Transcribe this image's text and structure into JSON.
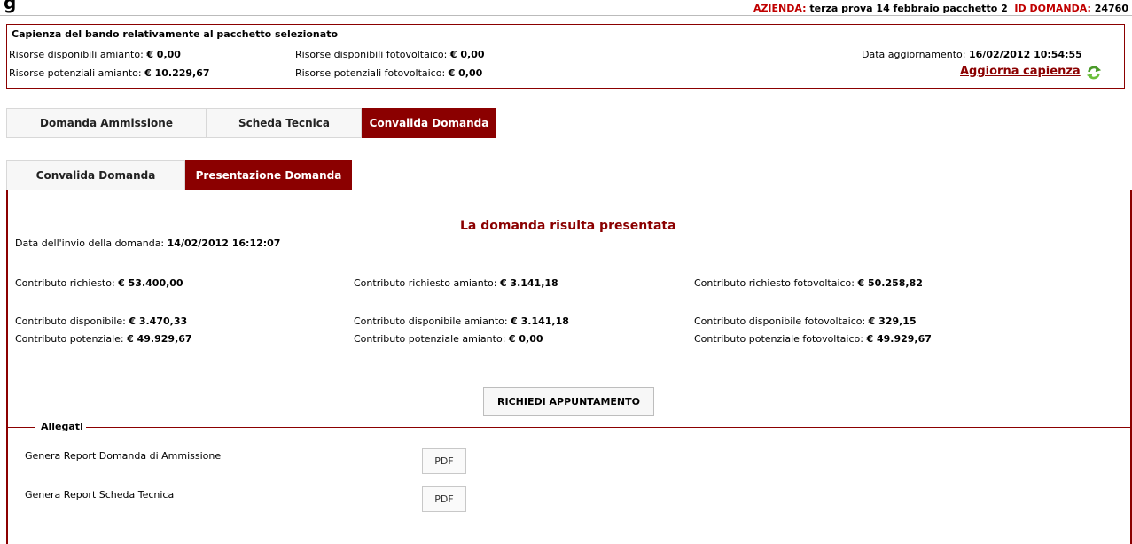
{
  "page_heading_glyph": "g",
  "header": {
    "azienda_label": "AZIENDA:",
    "azienda_value": "terza prova 14 febbraio pacchetto 2",
    "id_label": "ID DOMANDA:",
    "id_value": "24760"
  },
  "capienza": {
    "title": "Capienza del bando relativamente al pacchetto selezionato",
    "disp_amianto_label": "Risorse disponibili amianto:",
    "disp_amianto_value": "€ 0,00",
    "disp_foto_label": "Risorse disponibili fotovoltaico:",
    "disp_foto_value": "€ 0,00",
    "pot_amianto_label": "Risorse potenziali amianto:",
    "pot_amianto_value": "€ 10.229,67",
    "pot_foto_label": "Risorse potenziali fotovoltaico:",
    "pot_foto_value": "€ 0,00",
    "data_agg_label": "Data aggiornamento:",
    "data_agg_value": "16/02/2012 10:54:55",
    "aggiorna_link": "Aggiorna capienza"
  },
  "main_tabs": [
    {
      "label": "Domanda Ammissione",
      "active": false
    },
    {
      "label": "Scheda Tecnica",
      "active": false
    },
    {
      "label": "Convalida Domanda",
      "active": true
    }
  ],
  "sub_tabs": [
    {
      "label": "Convalida Domanda",
      "active": false
    },
    {
      "label": "Presentazione Domanda",
      "active": true
    }
  ],
  "panel": {
    "status_title": "La domanda risulta presentata",
    "invio_label": "Data dell'invio della domanda:",
    "invio_value": "14/02/2012 16:12:07",
    "rows": [
      [
        {
          "label": "Contributo richiesto:",
          "value": "€ 53.400,00"
        },
        {
          "label": "Contributo richiesto amianto:",
          "value": "€ 3.141,18"
        },
        {
          "label": "Contributo richiesto fotovoltaico:",
          "value": "€ 50.258,82"
        }
      ],
      [
        {
          "label": "Contributo disponibile:",
          "value": "€ 3.470,33"
        },
        {
          "label": "Contributo disponibile amianto:",
          "value": "€ 3.141,18"
        },
        {
          "label": "Contributo disponibile fotovoltaico:",
          "value": "€ 329,15"
        }
      ],
      [
        {
          "label": "Contributo potenziale:",
          "value": "€ 49.929,67"
        },
        {
          "label": "Contributo potenziale amianto:",
          "value": "€ 0,00"
        },
        {
          "label": "Contributo potenziale fotovoltaico:",
          "value": "€ 49.929,67"
        }
      ]
    ],
    "appuntamento_button": "RICHIEDI APPUNTAMENTO"
  },
  "allegati": {
    "legend": "Allegati",
    "items": [
      {
        "label": "Genera Report Domanda di Ammissione",
        "button": "PDF"
      },
      {
        "label": "Genera Report Scheda Tecnica",
        "button": "PDF"
      }
    ]
  },
  "colors": {
    "accent": "#8b0000",
    "header_red": "#c00000",
    "tab_inactive_bg": "#f7f7f7"
  },
  "icons": {
    "refresh": "refresh-icon"
  }
}
